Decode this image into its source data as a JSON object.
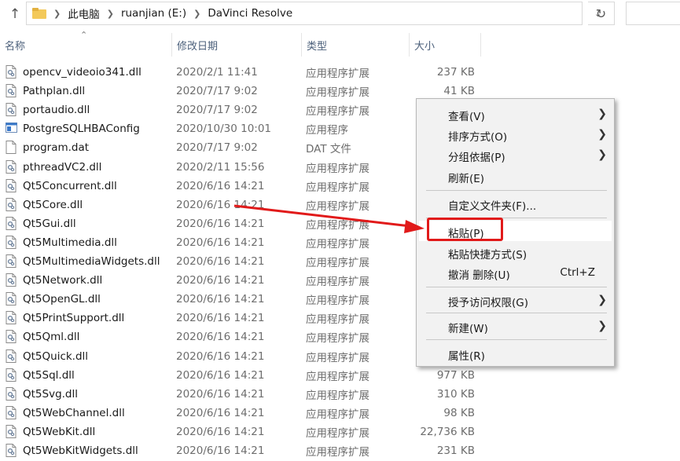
{
  "address_bar": {
    "crumbs": [
      "此电脑",
      "ruanjian (E:)",
      "DaVinci Resolve"
    ]
  },
  "columns": {
    "name": "名称",
    "date": "修改日期",
    "type": "类型",
    "size": "大小"
  },
  "files": [
    {
      "name": "opencv_videoio341.dll",
      "date": "2020/2/1 11:41",
      "type": "应用程序扩展",
      "size": "237 KB",
      "icon": "dll-file-icon"
    },
    {
      "name": "Pathplan.dll",
      "date": "2020/7/17 9:02",
      "type": "应用程序扩展",
      "size": "41 KB",
      "icon": "dll-file-icon"
    },
    {
      "name": "portaudio.dll",
      "date": "2020/7/17 9:02",
      "type": "应用程序扩展",
      "size": "",
      "icon": "dll-file-icon"
    },
    {
      "name": "PostgreSQLHBAConfig",
      "date": "2020/10/30 10:01",
      "type": "应用程序",
      "size": "",
      "icon": "application-icon"
    },
    {
      "name": "program.dat",
      "date": "2020/7/17 9:02",
      "type": "DAT 文件",
      "size": "",
      "icon": "blank-file-icon"
    },
    {
      "name": "pthreadVC2.dll",
      "date": "2020/2/11 15:56",
      "type": "应用程序扩展",
      "size": "",
      "icon": "dll-file-icon"
    },
    {
      "name": "Qt5Concurrent.dll",
      "date": "2020/6/16 14:21",
      "type": "应用程序扩展",
      "size": "",
      "icon": "dll-file-icon"
    },
    {
      "name": "Qt5Core.dll",
      "date": "2020/6/16 14:21",
      "type": "应用程序扩展",
      "size": "",
      "icon": "dll-file-icon"
    },
    {
      "name": "Qt5Gui.dll",
      "date": "2020/6/16 14:21",
      "type": "应用程序扩展",
      "size": "",
      "icon": "dll-file-icon"
    },
    {
      "name": "Qt5Multimedia.dll",
      "date": "2020/6/16 14:21",
      "type": "应用程序扩展",
      "size": "",
      "icon": "dll-file-icon"
    },
    {
      "name": "Qt5MultimediaWidgets.dll",
      "date": "2020/6/16 14:21",
      "type": "应用程序扩展",
      "size": "",
      "icon": "dll-file-icon"
    },
    {
      "name": "Qt5Network.dll",
      "date": "2020/6/16 14:21",
      "type": "应用程序扩展",
      "size": "",
      "icon": "dll-file-icon"
    },
    {
      "name": "Qt5OpenGL.dll",
      "date": "2020/6/16 14:21",
      "type": "应用程序扩展",
      "size": "",
      "icon": "dll-file-icon"
    },
    {
      "name": "Qt5PrintSupport.dll",
      "date": "2020/6/16 14:21",
      "type": "应用程序扩展",
      "size": "",
      "icon": "dll-file-icon"
    },
    {
      "name": "Qt5Qml.dll",
      "date": "2020/6/16 14:21",
      "type": "应用程序扩展",
      "size": "",
      "icon": "dll-file-icon"
    },
    {
      "name": "Qt5Quick.dll",
      "date": "2020/6/16 14:21",
      "type": "应用程序扩展",
      "size": "",
      "icon": "dll-file-icon"
    },
    {
      "name": "Qt5Sql.dll",
      "date": "2020/6/16 14:21",
      "type": "应用程序扩展",
      "size": "977 KB",
      "icon": "dll-file-icon"
    },
    {
      "name": "Qt5Svg.dll",
      "date": "2020/6/16 14:21",
      "type": "应用程序扩展",
      "size": "310 KB",
      "icon": "dll-file-icon"
    },
    {
      "name": "Qt5WebChannel.dll",
      "date": "2020/6/16 14:21",
      "type": "应用程序扩展",
      "size": "98 KB",
      "icon": "dll-file-icon"
    },
    {
      "name": "Qt5WebKit.dll",
      "date": "2020/6/16 14:21",
      "type": "应用程序扩展",
      "size": "22,736 KB",
      "icon": "dll-file-icon"
    },
    {
      "name": "Qt5WebKitWidgets.dll",
      "date": "2020/6/16 14:21",
      "type": "应用程序扩展",
      "size": "231 KB",
      "icon": "dll-file-icon"
    }
  ],
  "context_menu": {
    "view": "查看(V)",
    "sort_by": "排序方式(O)",
    "group_by": "分组依据(P)",
    "refresh": "刷新(E)",
    "customize_folder": "自定义文件夹(F)...",
    "paste": "粘贴(P)",
    "paste_shortcut": "粘贴快捷方式(S)",
    "undo_delete": "撤消 删除(U)",
    "undo_delete_shortcut": "Ctrl+Z",
    "give_access": "授予访问权限(G)",
    "new": "新建(W)",
    "properties": "属性(R)"
  },
  "annotation": {
    "highlight_color": "#e11a1a"
  }
}
